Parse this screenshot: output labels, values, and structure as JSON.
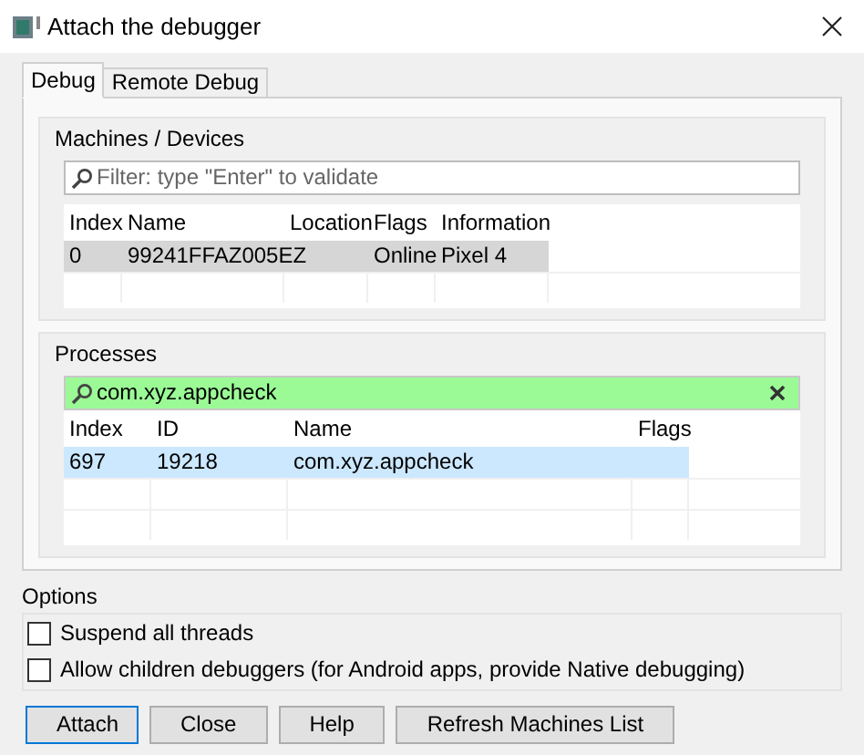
{
  "window": {
    "title": "Attach the debugger"
  },
  "tabs": [
    {
      "label": "Debug",
      "selected": true
    },
    {
      "label": "Remote Debug",
      "selected": false
    }
  ],
  "machines": {
    "title": "Machines / Devices",
    "filter": {
      "placeholder": "Filter: type \"Enter\" to validate",
      "matched": false
    },
    "columns": [
      "Index",
      "Name",
      "Location",
      "Flags",
      "Information"
    ],
    "rows": [
      {
        "index": "0",
        "name": "99241FFAZ005EZ",
        "flags": "Online",
        "information": "Pixel 4",
        "selected": true
      }
    ]
  },
  "processes": {
    "title": "Processes",
    "filter": {
      "value": "com.xyz.appcheck",
      "matched": true
    },
    "columns": [
      "Index",
      "ID",
      "Name",
      "Flags"
    ],
    "rows": [
      {
        "index": "697",
        "id": "19218",
        "name": "com.xyz.appcheck",
        "selected": true
      }
    ]
  },
  "options": {
    "title": "Options",
    "items": [
      {
        "label": "Suspend all threads",
        "checked": false
      },
      {
        "label": "Allow children debuggers (for Android apps, provide Native debugging)",
        "checked": false
      }
    ]
  },
  "buttons": [
    {
      "label": "Attach",
      "default": true
    },
    {
      "label": "Close",
      "default": false
    },
    {
      "label": "Help",
      "default": false
    },
    {
      "label": "Refresh Machines List",
      "default": false
    }
  ]
}
